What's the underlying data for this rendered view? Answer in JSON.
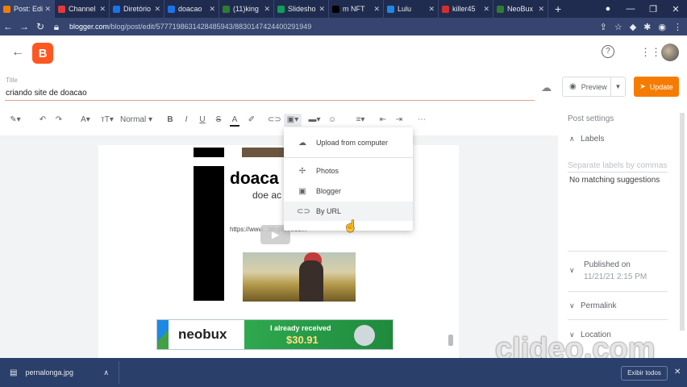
{
  "browser": {
    "tabs": [
      {
        "label": "Post: Edi",
        "color": "#f57c00",
        "active": true
      },
      {
        "label": "Channel",
        "color": "#e53935"
      },
      {
        "label": "Diretório",
        "color": "#1a73e8"
      },
      {
        "label": "doacao",
        "color": "#1a73e8"
      },
      {
        "label": "(11)king",
        "color": "#2e7d32"
      },
      {
        "label": "Slidesho",
        "color": "#0f9d58"
      },
      {
        "label": "m NFT",
        "color": "#000000"
      },
      {
        "label": "Lulu",
        "color": "#1e88e5"
      },
      {
        "label": "killer45",
        "color": "#d32f2f"
      },
      {
        "label": "NeoBux",
        "color": "#2e7d32"
      }
    ],
    "url_host": "blogger.com",
    "url_path": "/blog/post/edit/5777198631428485943/8830147424400291949"
  },
  "app": {
    "logo_letter": "B"
  },
  "post": {
    "title_label": "Title",
    "title_value": "criando site de doacao"
  },
  "actions": {
    "preview_label": "Preview",
    "update_label": "Update"
  },
  "toolbar": {
    "style_label": "Normal"
  },
  "image_menu": {
    "items": [
      {
        "label": "Upload from computer",
        "icon": "cloud-upload-icon"
      },
      {
        "label": "Photos",
        "icon": "photos-icon"
      },
      {
        "label": "Blogger",
        "icon": "blogger-icon"
      },
      {
        "label": "By URL",
        "icon": "link-icon"
      }
    ]
  },
  "document": {
    "heading": "doaca",
    "subheading": "doe ac",
    "link_text": "https://www.                         .blogspot.com",
    "banner_brand": "neobux",
    "banner_message": "I already received",
    "banner_amount": "$30.91"
  },
  "settings": {
    "title": "Post settings",
    "labels_header": "Labels",
    "labels_placeholder": "Separate labels by commas",
    "labels_message": "No matching suggestions",
    "published_label": "Published on",
    "published_value": "11/21/21 2:15 PM",
    "permalink_label": "Permalink",
    "location_label": "Location"
  },
  "watermark": "clideo.com",
  "downloads": {
    "file_name": "pernalonga.jpg",
    "show_all_label": "Exibir todos"
  }
}
